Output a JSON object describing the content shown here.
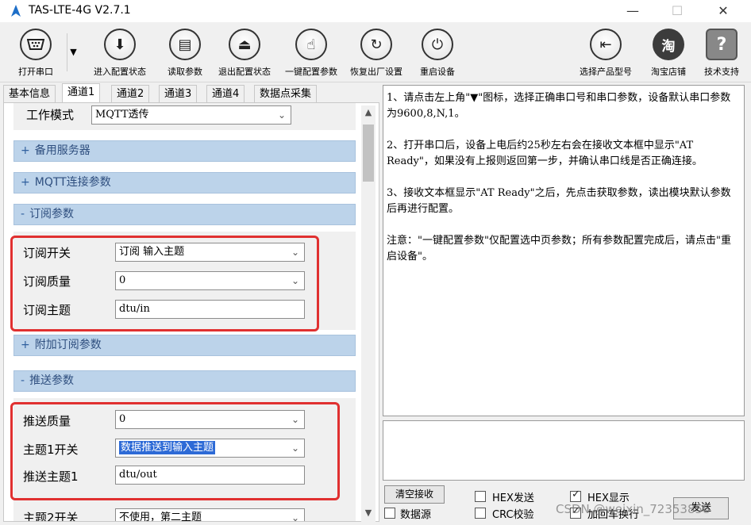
{
  "window": {
    "title": "TAS-LTE-4G V2.7.1",
    "minimize": "—",
    "maximize": "☐",
    "close": "✕"
  },
  "toolbar": {
    "open_port": "打开串口",
    "dropdown": "▼",
    "enter_config": "进入配置状态",
    "read_params": "读取参数",
    "exit_config": "退出配置状态",
    "one_key_config": "一键配置参数",
    "factory_reset": "恢复出厂设置",
    "restart": "重启设备",
    "select_model": "选择产品型号",
    "taobao": "淘宝店铺",
    "taobao_glyph": "淘",
    "support": "技术支持",
    "support_glyph": "?"
  },
  "tabs": [
    "基本信息",
    "通道1",
    "通道2",
    "通道3",
    "通道4",
    "数据点采集"
  ],
  "left": {
    "work_mode_label": "工作模式",
    "work_mode_value": "MQTT透传",
    "sections": {
      "backup_server": {
        "sym": "+",
        "label": "备用服务器"
      },
      "mqtt_conn": {
        "sym": "+",
        "label": "MQTT连接参数"
      },
      "subscribe": {
        "sym": "-",
        "label": "订阅参数"
      },
      "extra_subscribe": {
        "sym": "+",
        "label": "附加订阅参数"
      },
      "publish": {
        "sym": "-",
        "label": "推送参数"
      }
    },
    "subscribe_fields": {
      "switch_label": "订阅开关",
      "switch_value": "订阅   输入主题",
      "qos_label": "订阅质量",
      "qos_value": "0",
      "topic_label": "订阅主题",
      "topic_value": "dtu/in"
    },
    "publish_fields": {
      "qos_label": "推送质量",
      "qos_value": "0",
      "topic1_switch_label": "主题1开关",
      "topic1_switch_value": "数据推送到输入主题",
      "topic1_label": "推送主题1",
      "topic1_value": "dtu/out",
      "topic2_switch_label": "主题2开关",
      "topic2_switch_value": "不使用，第二主题"
    }
  },
  "info": {
    "p1": "1、请点击左上角\"▼\"图标，选择正确串口号和串口参数，设备默认串口参数为9600,8,N,1。",
    "p2": "2、打开串口后，设备上电后约25秒左右会在接收文本框中显示\"AT Ready\"，如果没有上报则返回第一步，并确认串口线是否正确连接。",
    "p3": "3、接收文本框显示\"AT Ready\"之后，先点击获取参数，读出模块默认参数后再进行配置。",
    "p4": "注意：\"一键配置参数\"仅配置选中页参数；所有参数配置完成后，请点击\"重启设备\"。"
  },
  "bottom": {
    "clear_recv": "清空接收",
    "data_source": "数据源",
    "hex_send": "HEX发送",
    "crc_check": "CRC校验",
    "hex_display": "HEX显示",
    "add_newline": "加回车换行",
    "send": "发送"
  },
  "watermark": "CSDN @weixin_72353858"
}
